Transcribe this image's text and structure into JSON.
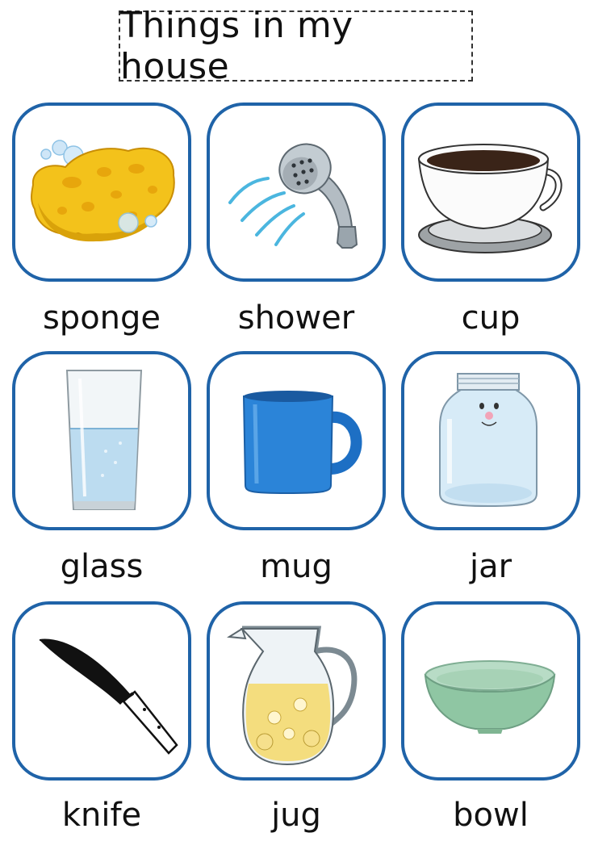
{
  "title": "Things in my house",
  "items": [
    {
      "label": "sponge",
      "icon": "sponge-icon"
    },
    {
      "label": "shower",
      "icon": "shower-icon"
    },
    {
      "label": "cup",
      "icon": "cup-icon"
    },
    {
      "label": "glass",
      "icon": "glass-icon"
    },
    {
      "label": "mug",
      "icon": "mug-icon"
    },
    {
      "label": "jar",
      "icon": "jar-icon"
    },
    {
      "label": "knife",
      "icon": "knife-icon"
    },
    {
      "label": "jug",
      "icon": "jug-icon"
    },
    {
      "label": "bowl",
      "icon": "bowl-icon"
    }
  ],
  "colors": {
    "card_border": "#1f63a8",
    "text": "#111111"
  }
}
